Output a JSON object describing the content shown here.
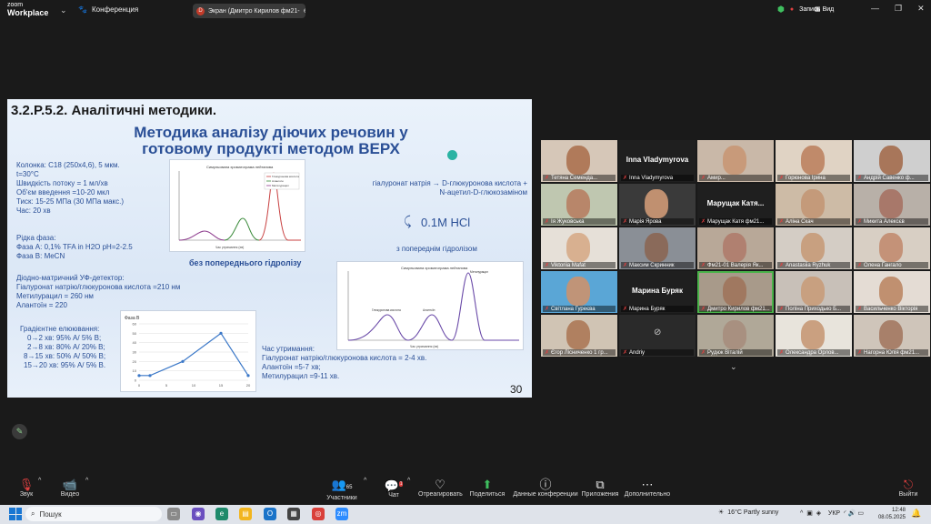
{
  "app": {
    "logo_line1": "zoom",
    "logo_line2": "Workplace"
  },
  "topbar": {
    "conference_label": "Конференция",
    "screen_share_label": "Экран (Дмитро Кирилов фм21-",
    "recording_label": "Запись",
    "view_label": "Вид"
  },
  "slide": {
    "section_title": "3.2.P.5.2. Аналітичні методики.",
    "main_title": "Методика аналізу діючих речовин у готовому продукті методом ВЕРХ",
    "column_lines": [
      "Колонка: C18 (250x4,6), 5 мкм.",
      "t=30°C",
      "Швидкість потоку = 1 мл/хв",
      "Об'єм введення =10-20 мкл",
      "Тиск: 15-25 МПа (30 МПа макс.)",
      "Час: 20 хв"
    ],
    "liquid_phase": [
      "Рідка фаза:",
      "Фаза А: 0,1% TFA in H2O pH=2-2.5",
      "Фаза В: MeCN"
    ],
    "detector": [
      "Діодно-матричний УФ-детектор:",
      "Гіалуронат натрію/глюкуронова кислота =210 нм",
      "Метилурацил = 260 нм",
      "Алантоїн = 220"
    ],
    "gradient": [
      "Градієнтне елюювання:",
      "0→2 хв: 95% А/ 5% В;",
      "2→8 хв: 80% А/ 20% В;",
      "8→15 хв: 50% А/ 50% В;",
      "15→20 хв: 95% А/ 5% В."
    ],
    "hydrolysis_lines": [
      "гіалуронат натрія → D-глюкуронова кислота +",
      "N-ацетил-D-глюкозаміном"
    ],
    "hcl_label": "0.1М HCl",
    "with_hydrolysis": "з попереднім гідролізом",
    "without_hydrolysis": "без попереднього гідролізу",
    "retention": [
      "Час утримання:",
      "Гіалуронат натрію/глюкуронова кислота = 2-4 хв.",
      "Алантоїн =5-7 хв;",
      "Метилурацил =9-11 хв."
    ],
    "page_number": "30",
    "chart1_title": "Симульована хроматограма лейтанова",
    "chart2_title": "Симульована хроматограма лейтанова",
    "chart2_xlabel": "Час утримання (хв)",
    "chart1_xlabel": "Час утримання (хв)",
    "chart2_peak_labels": [
      "Глюкуронова кислота",
      "Алантоїн",
      "Метилурацил"
    ],
    "chart_legend": [
      "Глюкуронова кислота",
      "Алантоїн",
      "Метилурацил"
    ]
  },
  "chart_data": [
    {
      "type": "line",
      "title": "Фаза В",
      "x": [
        0,
        2,
        8,
        15,
        20
      ],
      "series": [
        {
          "values": [
            5,
            5,
            20,
            50,
            5
          ]
        }
      ],
      "xlim": [
        0,
        20
      ],
      "ylim": [
        0,
        60
      ],
      "xticks": [
        0,
        5,
        10,
        15,
        20
      ],
      "yticks": [
        0,
        10,
        20,
        30,
        40,
        50,
        60
      ],
      "grid": true
    }
  ],
  "gallery": {
    "tiles": [
      {
        "name": "Тетяна Семенда...",
        "bigname": ""
      },
      {
        "name": "Inna Vladymyrova",
        "bigname": "Inna Vladymyrova"
      },
      {
        "name": "Амир...",
        "bigname": ""
      },
      {
        "name": "Горюнова Ірина",
        "bigname": ""
      },
      {
        "name": "Андрій Савенко ф...",
        "bigname": ""
      },
      {
        "name": "Ія Жуковська",
        "bigname": ""
      },
      {
        "name": "Марія Ярова",
        "bigname": ""
      },
      {
        "name": "Марущак Катя фм21...",
        "bigname": "Марущак Катя..."
      },
      {
        "name": "Аліна Скач",
        "bigname": ""
      },
      {
        "name": "Микита Алексєв",
        "bigname": ""
      },
      {
        "name": "Viktoriia Mafat",
        "bigname": ""
      },
      {
        "name": "Максим Скринник",
        "bigname": ""
      },
      {
        "name": "Фм21-01 Валерія Як...",
        "bigname": ""
      },
      {
        "name": "Anastasiia Ryzhuk",
        "bigname": ""
      },
      {
        "name": "Олена Гангало",
        "bigname": ""
      },
      {
        "name": "Світлана Гуреєва",
        "bigname": ""
      },
      {
        "name": "Марина Буряк",
        "bigname": "Марина Буряк"
      },
      {
        "name": "Дмитро Кирилов фм21...",
        "bigname": ""
      },
      {
        "name": "Поліна Приходько Б...",
        "bigname": ""
      },
      {
        "name": "Васильченко Вікторія",
        "bigname": ""
      },
      {
        "name": "Єгор Лісниченко 1 гр...",
        "bigname": ""
      },
      {
        "name": "Andriy",
        "bigname": ""
      },
      {
        "name": "Рудюк Віталій",
        "bigname": ""
      },
      {
        "name": "Олександра Орлов...",
        "bigname": ""
      },
      {
        "name": "Нагорна Юлія фм21...",
        "bigname": ""
      }
    ]
  },
  "toolbar": {
    "audio": "Звук",
    "video": "Видео",
    "participants": "Участники",
    "participants_count": "65",
    "chat": "Чат",
    "chat_badge": "1",
    "react": "Отреагировать",
    "share": "Поделиться",
    "conf_data": "Данные конференции",
    "apps": "Приложения",
    "more": "Дополнительно",
    "exit": "Выйти"
  },
  "taskbar": {
    "search_placeholder": "Пошук",
    "weather": "16°C  Partly sunny",
    "lang": "УКР",
    "time": "12:48",
    "date": "08.05.2025"
  }
}
